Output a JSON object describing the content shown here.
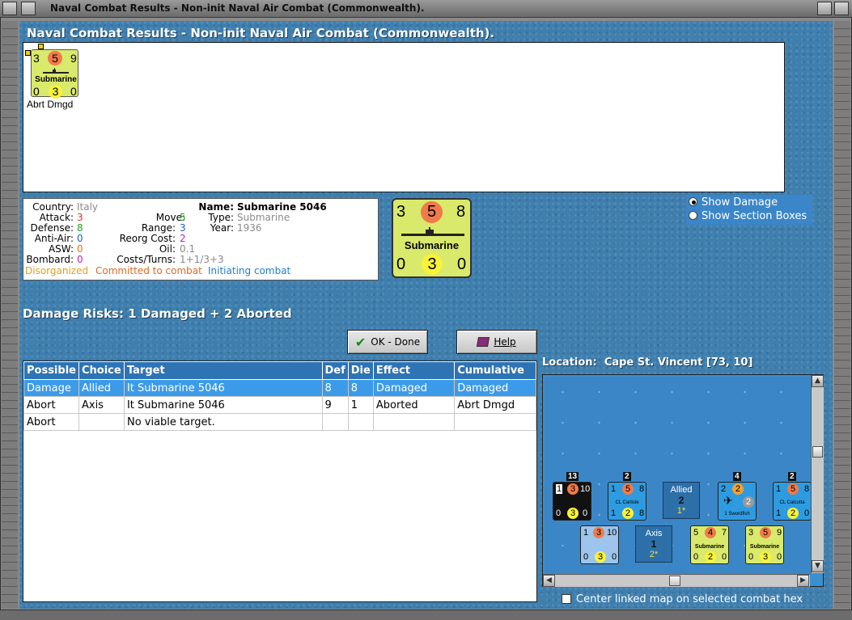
{
  "window": {
    "title": "Naval Combat Results - Non-init Naval Air Combat (Commonwealth)."
  },
  "header": {
    "title": "Naval Combat Results - Non-init Naval Air Combat (Commonwealth)."
  },
  "result_unit": {
    "attack": "3",
    "defense": "5",
    "move": "9",
    "type": "Submarine",
    "bottom_left": "0",
    "bottom_mid": "3",
    "bottom_right": "0",
    "status": "Abrt Dmgd"
  },
  "info": {
    "labels": {
      "country": "Country:",
      "attack": "Attack:",
      "defense": "Defense:",
      "anti_air": "Anti-Air:",
      "asw": "ASW:",
      "bombard": "Bombard:",
      "name": "Name:",
      "move": "Move:",
      "type": "Type:",
      "range": "Range:",
      "year": "Year:",
      "reorg_cost": "Reorg Cost:",
      "oil": "Oil:",
      "costs_turns": "Costs/Turns:"
    },
    "country": "Italy",
    "attack": "3",
    "defense": "8",
    "anti_air": "0",
    "asw": "0",
    "bombard": "0",
    "name": "Submarine 5046",
    "move": "5",
    "type": "Submarine",
    "range": "3",
    "year": "1936",
    "reorg_cost": "2",
    "oil": "0.1",
    "costs_turns": "1+1/3+3",
    "status_disorganized": "Disorganized",
    "status_committed": "Committed to combat",
    "status_initiating": "Initiating combat",
    "colors": {
      "disorganized": "#e0a020",
      "committed": "#e06a20",
      "initiating": "#2080d0"
    }
  },
  "big_counter": {
    "attack": "3",
    "defense": "5",
    "move": "8",
    "type": "Submarine",
    "bottom_left": "0",
    "bottom_mid": "3",
    "bottom_right": "0"
  },
  "display_options": {
    "show_damage": "Show Damage",
    "show_section_boxes": "Show Section Boxes",
    "selected": "show_damage"
  },
  "damage_risks": "Damage Risks:  1 Damaged + 2 Aborted",
  "buttons": {
    "ok": "OK - Done",
    "help": "Help"
  },
  "table": {
    "headers": [
      "Possible",
      "Choice",
      "Target",
      "Def",
      "Die",
      "Effect",
      "Cumulative"
    ],
    "rows": [
      [
        "Damage",
        "Allied",
        "It Submarine 5046",
        "8",
        "8",
        "Damaged",
        "Damaged"
      ],
      [
        "Abort",
        "Axis",
        "It Submarine 5046",
        "9",
        "1",
        "Aborted",
        "Abrt Dmgd"
      ],
      [
        "Abort",
        "",
        "No viable target.",
        "",
        "",
        "",
        ""
      ]
    ],
    "selected_row": 0
  },
  "location": {
    "label": "Location:",
    "value": "Cape St. Vincent [73, 10]"
  },
  "map": {
    "allied_units": [
      {
        "flag": "13",
        "a": "1",
        "b": "3",
        "c": "10",
        "d": "0",
        "e": "3",
        "f": "0",
        "caption": "",
        "theme": "black"
      },
      {
        "flag": "2",
        "a": "1",
        "b": "5",
        "c": "8",
        "d": "1",
        "e": "2",
        "f": "8",
        "caption": "CL Carlisle",
        "theme": "blue"
      },
      {
        "flag": "4",
        "a": "2",
        "b": "2",
        "c": "2",
        "d": "",
        "e": "",
        "f": "",
        "caption": "1 Swordfish",
        "theme": "blue"
      },
      {
        "flag": "2",
        "a": "1",
        "b": "5",
        "c": "8",
        "d": "1",
        "e": "2",
        "f": "0",
        "caption": "CL Calcutta",
        "theme": "blue"
      }
    ],
    "allied_box": {
      "label": "Allied",
      "count": "2",
      "sub": "1*"
    },
    "axis_box": {
      "label": "Axis",
      "count": "1",
      "sub": "2*"
    },
    "axis_units": [
      {
        "a": "1",
        "b": "3",
        "c": "10",
        "d": "0",
        "e": "3",
        "f": "0",
        "caption": "",
        "theme": "lightblue"
      },
      {
        "a": "5",
        "b": "4",
        "c": "7",
        "d": "0",
        "e": "2",
        "f": "0",
        "caption": "Submarine",
        "theme": "yellow"
      },
      {
        "a": "3",
        "b": "5",
        "c": "9",
        "d": "0",
        "e": "3",
        "f": "0",
        "caption": "Submarine",
        "theme": "yellow"
      }
    ]
  },
  "center_map_checkbox": "Center linked map on selected combat hex"
}
